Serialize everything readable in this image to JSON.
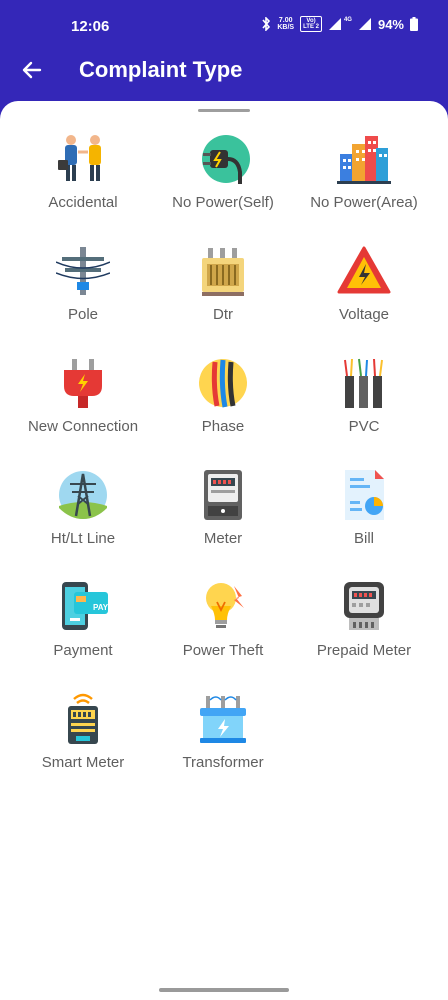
{
  "status": {
    "time": "12:06",
    "netspeed_value": "7.00",
    "netspeed_unit": "KB/S",
    "volte_top": "Vo)",
    "volte_bottom": "LTE 2",
    "network": "4G",
    "battery": "94%"
  },
  "header": {
    "title": "Complaint Type"
  },
  "colors": {
    "primary": "#3427b8",
    "label": "#5f5f5f"
  },
  "complaint_types": [
    {
      "label": "Accidental",
      "icon": "people-accident-icon"
    },
    {
      "label": "No Power(Self)",
      "icon": "plug-icon"
    },
    {
      "label": "No Power(Area)",
      "icon": "buildings-icon"
    },
    {
      "label": "Pole",
      "icon": "pole-icon"
    },
    {
      "label": "Dtr",
      "icon": "dtr-icon"
    },
    {
      "label": "Voltage",
      "icon": "voltage-warning-icon"
    },
    {
      "label": "New Connection",
      "icon": "red-plug-icon"
    },
    {
      "label": "Phase",
      "icon": "phase-wires-icon"
    },
    {
      "label": "PVC",
      "icon": "pvc-cables-icon"
    },
    {
      "label": "Ht/Lt Line",
      "icon": "tower-icon"
    },
    {
      "label": "Meter",
      "icon": "meter-icon"
    },
    {
      "label": "Bill",
      "icon": "bill-icon"
    },
    {
      "label": "Payment",
      "icon": "payment-icon"
    },
    {
      "label": "Power Theft",
      "icon": "bulb-icon"
    },
    {
      "label": "Prepaid Meter",
      "icon": "prepaid-meter-icon"
    },
    {
      "label": "Smart Meter",
      "icon": "smart-meter-icon"
    },
    {
      "label": "Transformer",
      "icon": "transformer-icon"
    }
  ]
}
